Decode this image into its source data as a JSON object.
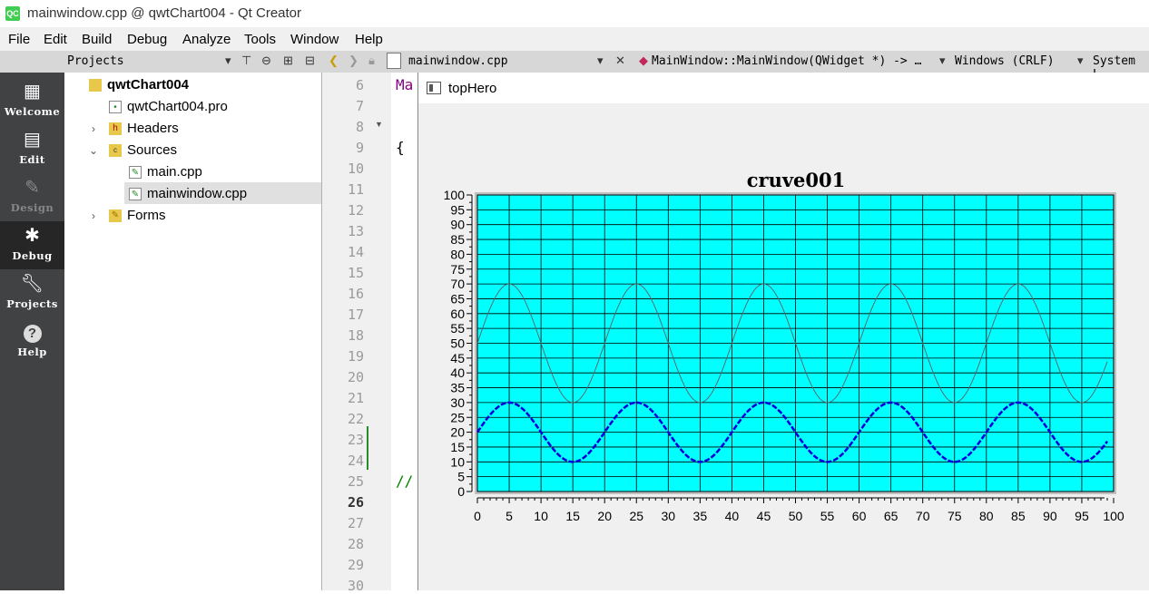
{
  "window": {
    "title": "mainwindow.cpp @ qwtChart004 - Qt Creator",
    "app_icon": "QC"
  },
  "menu": [
    "File",
    "Edit",
    "Build",
    "Debug",
    "Analyze",
    "Tools",
    "Window",
    "Help"
  ],
  "toolbar": {
    "panel_title": "Projects",
    "file_tab": "mainwindow.cpp",
    "function_selector": "MainWindow::MainWindow(QWidget *) -> …",
    "line_ending": "Windows (CRLF)",
    "encoding": "System L"
  },
  "modes": [
    {
      "label": "Welcome",
      "icon": "grid-icon"
    },
    {
      "label": "Edit",
      "icon": "document-icon"
    },
    {
      "label": "Design",
      "icon": "pencil-icon"
    },
    {
      "label": "Debug",
      "icon": "bug-icon"
    },
    {
      "label": "Projects",
      "icon": "wrench-icon"
    },
    {
      "label": "Help",
      "icon": "help-icon"
    }
  ],
  "tree": {
    "project": "qwtChart004",
    "pro_file": "qwtChart004.pro",
    "headers": "Headers",
    "sources": "Sources",
    "main_cpp": "main.cpp",
    "mainwindow_cpp": "mainwindow.cpp",
    "forms": "Forms"
  },
  "editor": {
    "line_numbers": [
      "6",
      "7",
      "8",
      "9",
      "10",
      "11",
      "12",
      "13",
      "14",
      "15",
      "16",
      "17",
      "18",
      "19",
      "20",
      "21",
      "22",
      "23",
      "24",
      "25",
      "26",
      "27",
      "28",
      "29",
      "30"
    ],
    "current_line": "26",
    "code_line6": "Ma",
    "code_line9": "{",
    "code_line25": "//"
  },
  "hero": {
    "title": "topHero"
  },
  "chart_data": {
    "type": "line",
    "title": "cruve001",
    "xlabel": "",
    "ylabel": "",
    "xlim": [
      0,
      100
    ],
    "ylim": [
      0,
      100
    ],
    "x_ticks": [
      "0",
      "5",
      "10",
      "15",
      "20",
      "25",
      "30",
      "35",
      "40",
      "45",
      "50",
      "55",
      "60",
      "65",
      "70",
      "75",
      "80",
      "85",
      "90",
      "95",
      "100"
    ],
    "y_ticks": [
      "0",
      "5",
      "10",
      "15",
      "20",
      "25",
      "30",
      "35",
      "40",
      "45",
      "50",
      "55",
      "60",
      "65",
      "70",
      "75",
      "80",
      "85",
      "90",
      "95",
      "100"
    ],
    "grid": true,
    "background": "#00ffff",
    "series": [
      {
        "color": "#606060",
        "style": "thin-solid",
        "x_start": 0,
        "x_end": 99,
        "formula": "50 + 20*sin(2*pi*x/20)",
        "min": 30,
        "max": 70
      },
      {
        "color": "#0000dd",
        "style": "thick-dashed",
        "x_start": 0,
        "x_end": 99,
        "formula": "20 + 10*sin(2*pi*x/20)",
        "min": 10,
        "max": 30
      }
    ]
  }
}
